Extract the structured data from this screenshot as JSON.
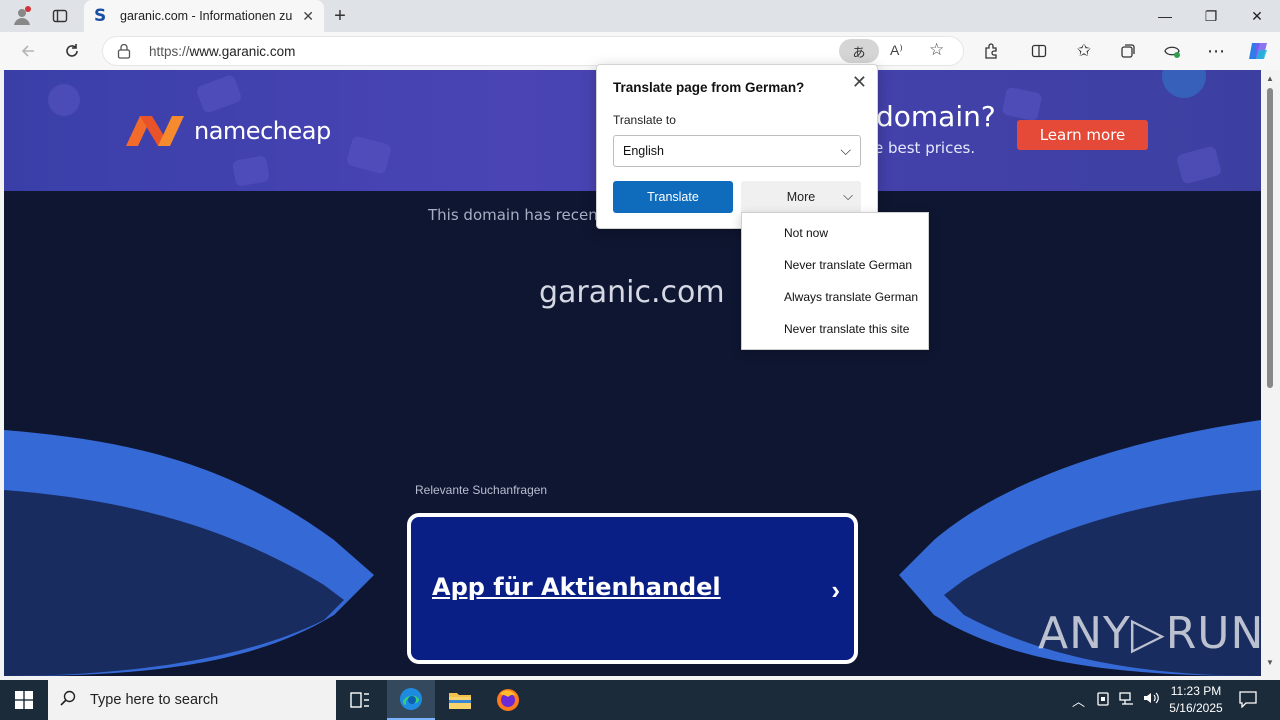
{
  "browser": {
    "tab": {
      "favicon": "S",
      "title": "garanic.com - Informationen zum",
      "close": "✕"
    },
    "new_tab": "+",
    "window": {
      "minimize": "—",
      "restore": "❐",
      "close": "✕"
    },
    "url": {
      "protocol": "https://",
      "host": "www.garanic.com"
    }
  },
  "page": {
    "banner": {
      "brand": "namecheap",
      "headline": "domain?",
      "subtext": "e best prices.",
      "cta": "Learn more"
    },
    "notice": "This domain has recently",
    "domain": "garanic.com",
    "related_label": "Relevante Suchanfragen",
    "ad_link": "App für Aktienhandel",
    "watermark": "ANY▷RUN"
  },
  "translate_popup": {
    "title": "Translate page from German?",
    "label": "Translate to",
    "selected_language": "English",
    "translate_button": "Translate",
    "more_button": "More",
    "menu_items": [
      "Not now",
      "Never translate German",
      "Always translate German",
      "Never translate this site"
    ]
  },
  "taskbar": {
    "search_placeholder": "Type here to search",
    "time": "11:23 PM",
    "date": "5/16/2025"
  },
  "colors": {
    "page_bg": "#0f1631",
    "banner_bg": "#4a44b5",
    "accent_blue": "#0f6cbd",
    "cta_red": "#e44a37",
    "ad_box": "#0a1f86"
  }
}
